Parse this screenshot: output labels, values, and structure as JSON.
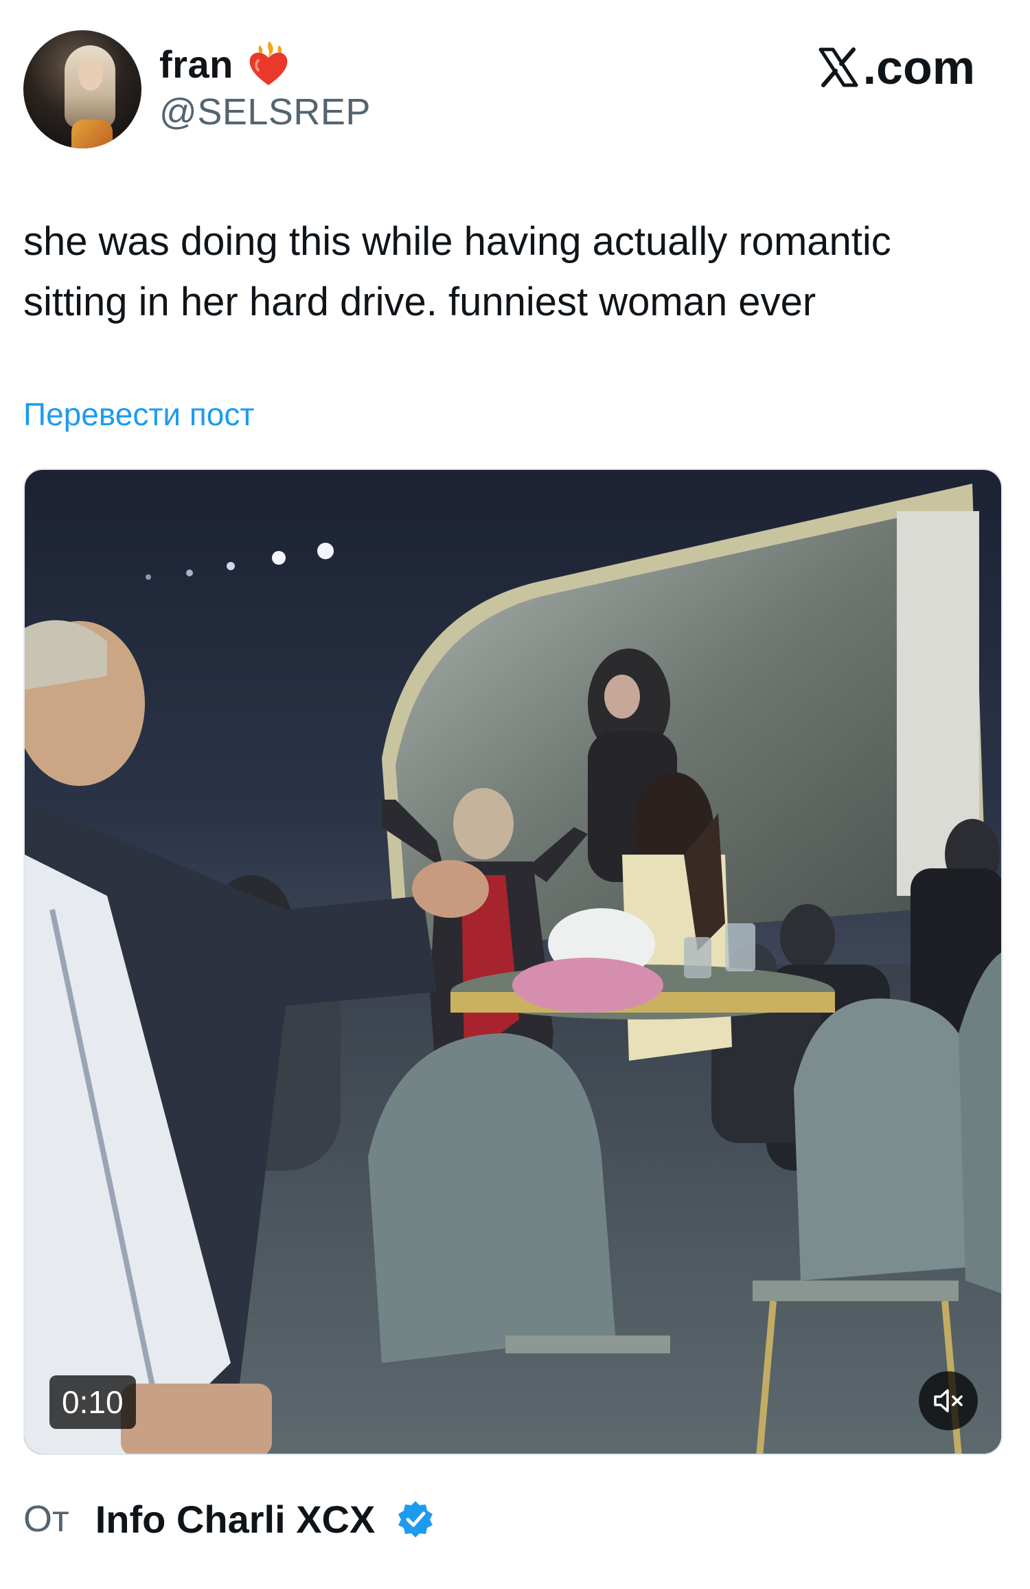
{
  "header": {
    "display_name": "fran",
    "handle": "@SELSREP",
    "site_label": ".com"
  },
  "post": {
    "text": "she was doing this while having actually romantic sitting in her hard drive. funniest woman ever",
    "translate_label": "Перевести пост"
  },
  "media": {
    "duration": "0:10",
    "mute_icon": "speaker-muted-icon"
  },
  "footer": {
    "from_label": "От",
    "source_name": "Info Charli XCX",
    "verified_icon": "verified-badge-icon"
  },
  "colors": {
    "link": "#1d9bf0",
    "secondary_text": "#536471",
    "primary_text": "#0f1419",
    "verified": "#1d9bf0"
  }
}
